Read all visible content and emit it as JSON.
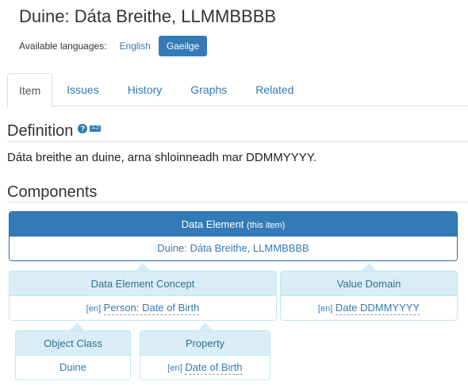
{
  "page_title": "Duine: Dáta Breithe, LLMMBBBB",
  "languages": {
    "label": "Available languages:",
    "options": [
      "English",
      "Gaeilge"
    ],
    "active": "Gaeilge"
  },
  "tabs": [
    "Item",
    "Issues",
    "History",
    "Graphs",
    "Related"
  ],
  "active_tab": "Item",
  "definition": {
    "heading": "Definition",
    "help_glyph": "?",
    "az_glyph": "A-Z",
    "text": "Dáta breithe an duine, arna shloinneadh mar DDMMYYYY."
  },
  "components": {
    "heading": "Components",
    "data_element": {
      "title": "Data Element",
      "note": "(this item)",
      "value": "Duine: Dáta Breithe, LLMMBBBB"
    },
    "data_element_concept": {
      "title": "Data Element Concept",
      "lang": "[en]",
      "value": "Person: Date of Birth"
    },
    "value_domain": {
      "title": "Value Domain",
      "lang": "[en]",
      "value": "Date DDMMYYYY"
    },
    "object_class": {
      "title": "Object Class",
      "value": "Duine"
    },
    "property": {
      "title": "Property",
      "lang": "[en]",
      "value": "Date of Birth"
    }
  },
  "colors": {
    "primary": "#337ab7",
    "info_bg": "#d9edf7",
    "info_border": "#bce8f1",
    "info_text": "#31708f"
  }
}
